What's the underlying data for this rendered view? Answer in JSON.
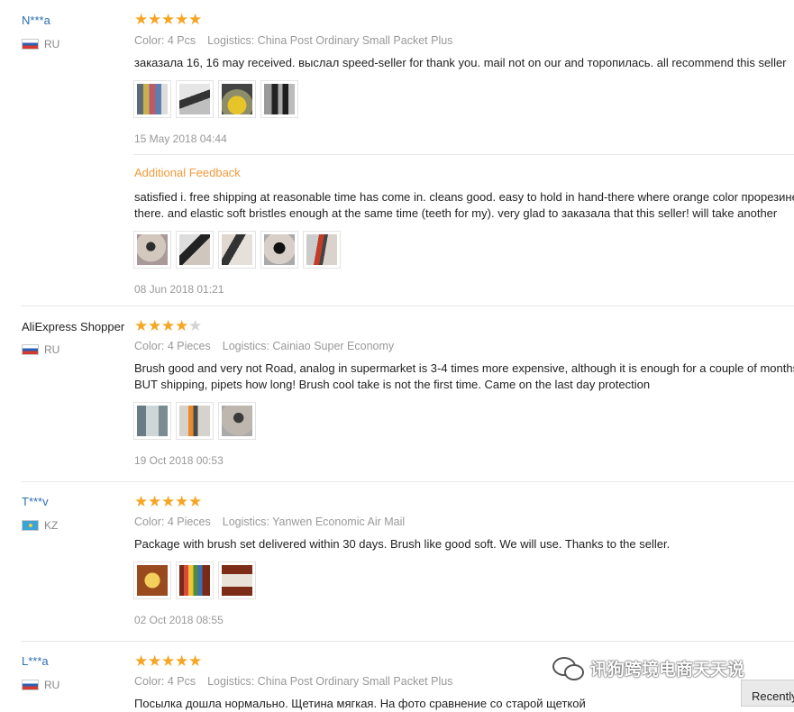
{
  "reviews": [
    {
      "user": "N***a",
      "country": "RU",
      "stars": 5,
      "color": "Color: 4 Pcs",
      "logistics": "Logistics: China Post Ordinary Small Packet Plus",
      "text": "заказала 16, 16 may received. выслал speed-seller for thank you. mail not on our and торопилась. all recommend this seller",
      "date": "15 May 2018 04:44",
      "additional_label": "Additional Feedback",
      "additional_text_line1": "satisfied i. free shipping at reasonable time has come in. cleans good. easy to hold in hand-there where orange color прорезиненное",
      "additional_text_line2": "there. and elastic soft bristles enough at the same time (teeth for my). very glad to заказала that this seller! will take another",
      "additional_date": "08 Jun 2018 01:21"
    },
    {
      "user": "AliExpress Shopper",
      "country": "RU",
      "stars": 4,
      "color": "Color: 4 Pieces",
      "logistics": "Logistics: Cainiao Super Economy",
      "text_line1": "Brush good and very not Road, analog in supermarket is 3-4 times more expensive, although it is enough for a couple of months.",
      "text_line2": "BUT shipping, pipets how long! Brush cool take is not the first time. Came on the last day protection",
      "date": "19 Oct 2018 00:53"
    },
    {
      "user": "T***v",
      "country": "KZ",
      "stars": 5,
      "color": "Color: 4 Pieces",
      "logistics": "Logistics: Yanwen Economic Air Mail",
      "text": "Package with brush set delivered within 30 days. Brush like good soft. We will use. Thanks to the seller.",
      "date": "02 Oct 2018 08:55"
    },
    {
      "user": "L***a",
      "country": "RU",
      "stars": 5,
      "color": "Color: 4 Pcs",
      "logistics": "Logistics: China Post Ordinary Small Packet Plus",
      "text": "Посылка дошла нормально. Щетина мягкая. На фото сравнение со старой щеткой"
    }
  ],
  "watermark": "讯狗跨境电商天天说",
  "recent_button": "Recently"
}
